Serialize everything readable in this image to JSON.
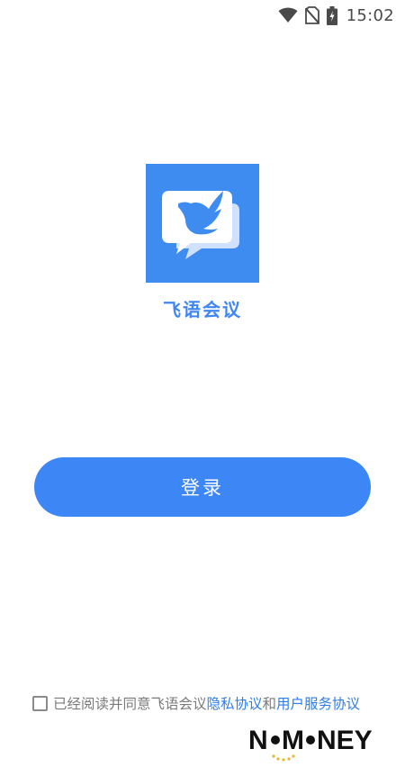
{
  "status_bar": {
    "time": "15:02",
    "icons": [
      "wifi-icon",
      "no-sim-icon",
      "battery-charging-icon"
    ]
  },
  "app": {
    "name": "飞语会议",
    "logo_icon": "bird-chat-logo-icon",
    "brand_color": "#3f8cf1"
  },
  "login": {
    "button_label": "登录",
    "button_color": "#3d86f5"
  },
  "agreement": {
    "checked": false,
    "prefix": "已经阅读并同意飞语会议",
    "privacy_link": "隐私协议",
    "conjunction": "和",
    "service_link": "用户服务协议",
    "link_color": "#2f7de8"
  },
  "watermark": {
    "text": "NOMONEY"
  }
}
